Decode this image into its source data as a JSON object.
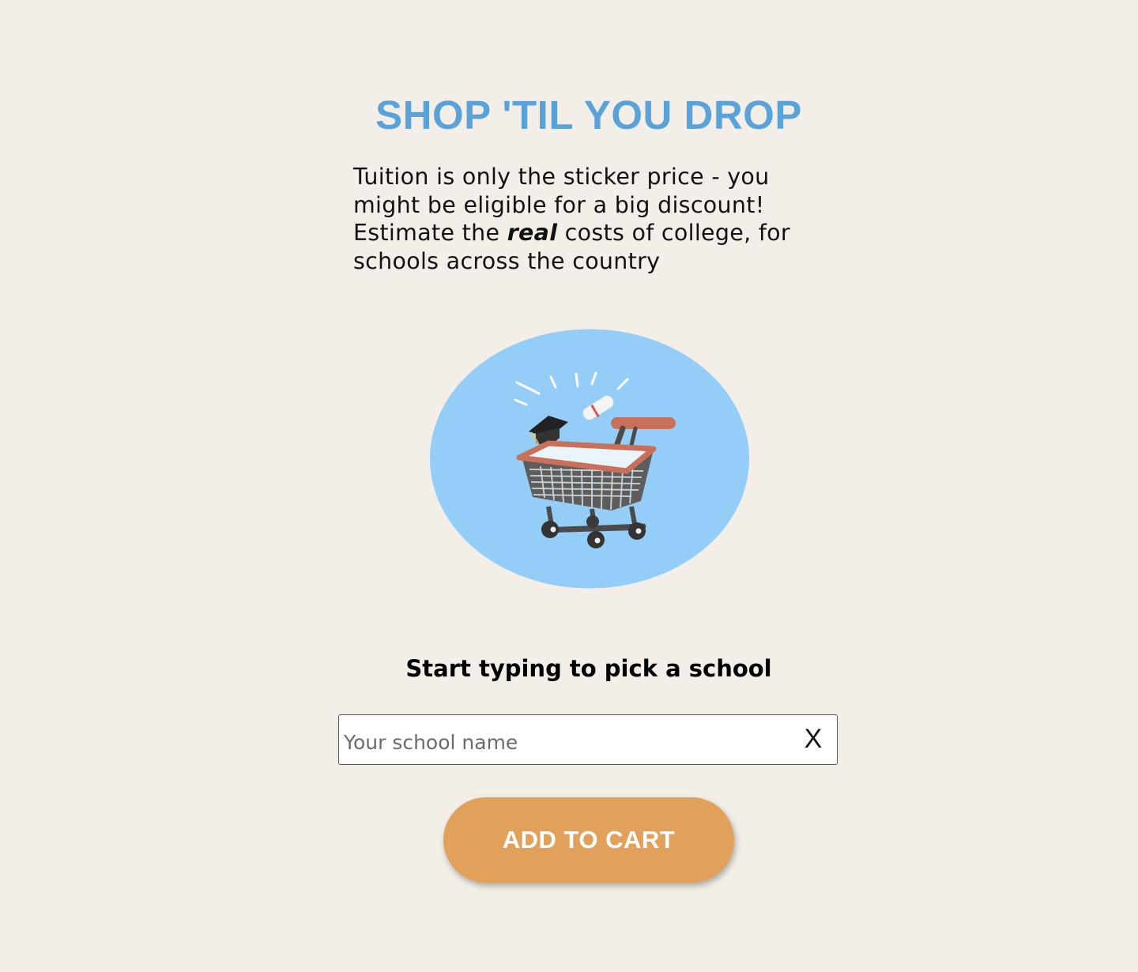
{
  "header": {
    "title": "SHOP 'TIL YOU DROP"
  },
  "intro": {
    "text_before": "Tuition is only the sticker price - you might be eligible for a big discount! Estimate the ",
    "emphasis": "real",
    "text_after": " costs of college, for schools across the country"
  },
  "illustration": {
    "icons": [
      "shopping-cart-icon",
      "graduation-cap-icon",
      "diploma-icon"
    ],
    "circle_color": "#94cdf7",
    "cart_handle_color": "#c9705b"
  },
  "search": {
    "label": "Start typing to pick a school",
    "placeholder": "Your school name",
    "value": "",
    "clear_label": "X"
  },
  "actions": {
    "add_to_cart_label": "ADD TO CART",
    "button_color": "#e1a15a"
  },
  "colors": {
    "background": "#f3efe8",
    "title": "#5aa3d9"
  }
}
